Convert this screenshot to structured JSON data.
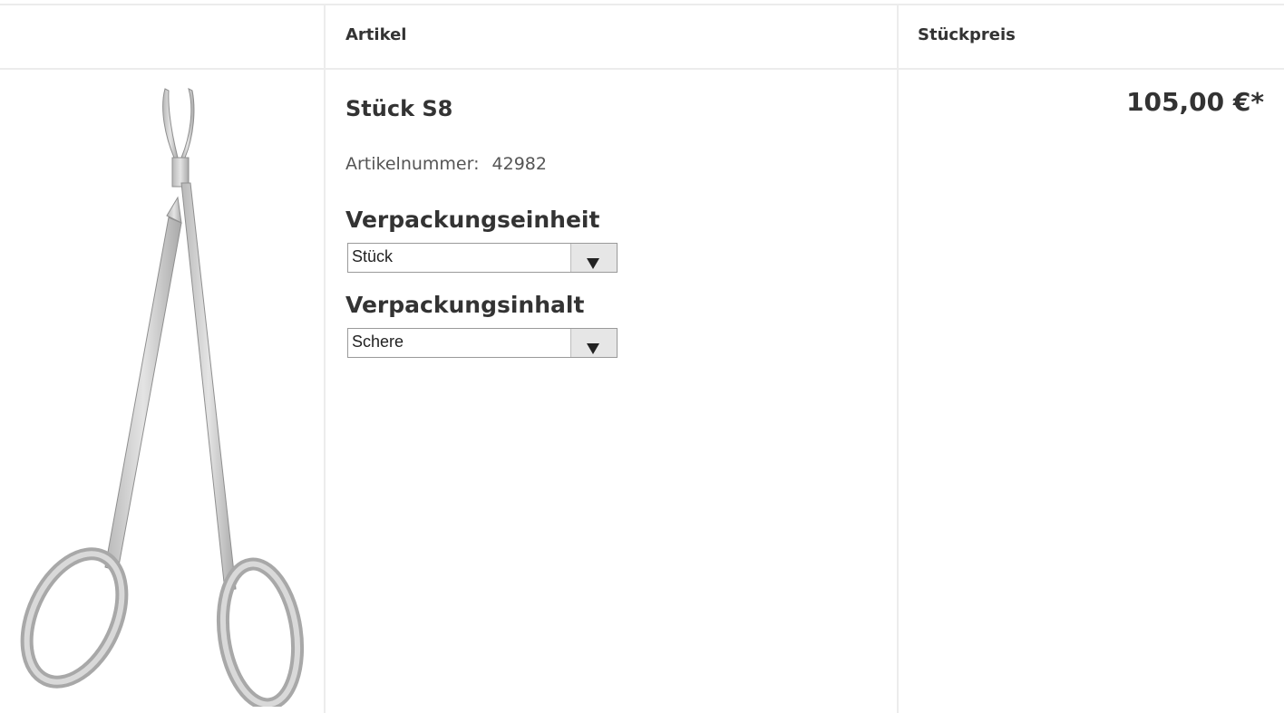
{
  "table": {
    "headers": [
      "",
      "Artikel",
      "Stückpreis"
    ]
  },
  "product": {
    "image_icon": "surgical-scissors-image",
    "name": "Stück S8",
    "article_number_label": "Artikelnummer:",
    "article_number": "42982",
    "packaging_unit_label": "Verpackungseinheit",
    "packaging_unit_value": "Stück",
    "packaging_content_label": "Verpackungsinhalt",
    "packaging_content_value": "Schere",
    "price": "105,00 €*"
  },
  "colors": {
    "border": "#ececec",
    "text": "#333333",
    "select_button": "#e6e6e6"
  }
}
